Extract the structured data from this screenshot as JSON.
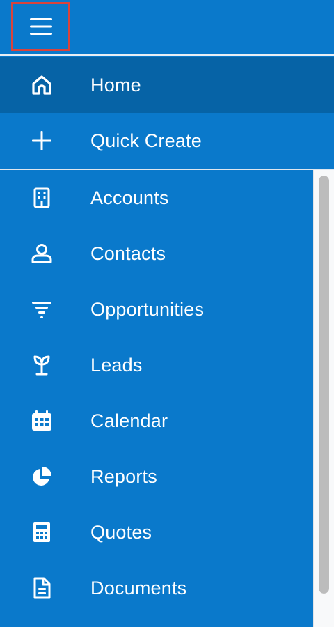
{
  "menu_button": {
    "icon": "hamburger-icon"
  },
  "pinned_items": [
    {
      "label": "Home",
      "icon": "home-icon",
      "active": true
    },
    {
      "label": "Quick Create",
      "icon": "plus-icon",
      "active": false
    }
  ],
  "modules": [
    {
      "label": "Accounts",
      "icon": "building-icon"
    },
    {
      "label": "Contacts",
      "icon": "person-icon"
    },
    {
      "label": "Opportunities",
      "icon": "filter-icon"
    },
    {
      "label": "Leads",
      "icon": "sprout-icon"
    },
    {
      "label": "Calendar",
      "icon": "calendar-icon"
    },
    {
      "label": "Reports",
      "icon": "pie-chart-icon"
    },
    {
      "label": "Quotes",
      "icon": "calculator-icon"
    },
    {
      "label": "Documents",
      "icon": "document-icon"
    }
  ],
  "colors": {
    "sidebar_bg": "#0a79cb",
    "active_bg": "#0663a6",
    "highlight_border": "#d9433c",
    "text": "#ffffff"
  }
}
